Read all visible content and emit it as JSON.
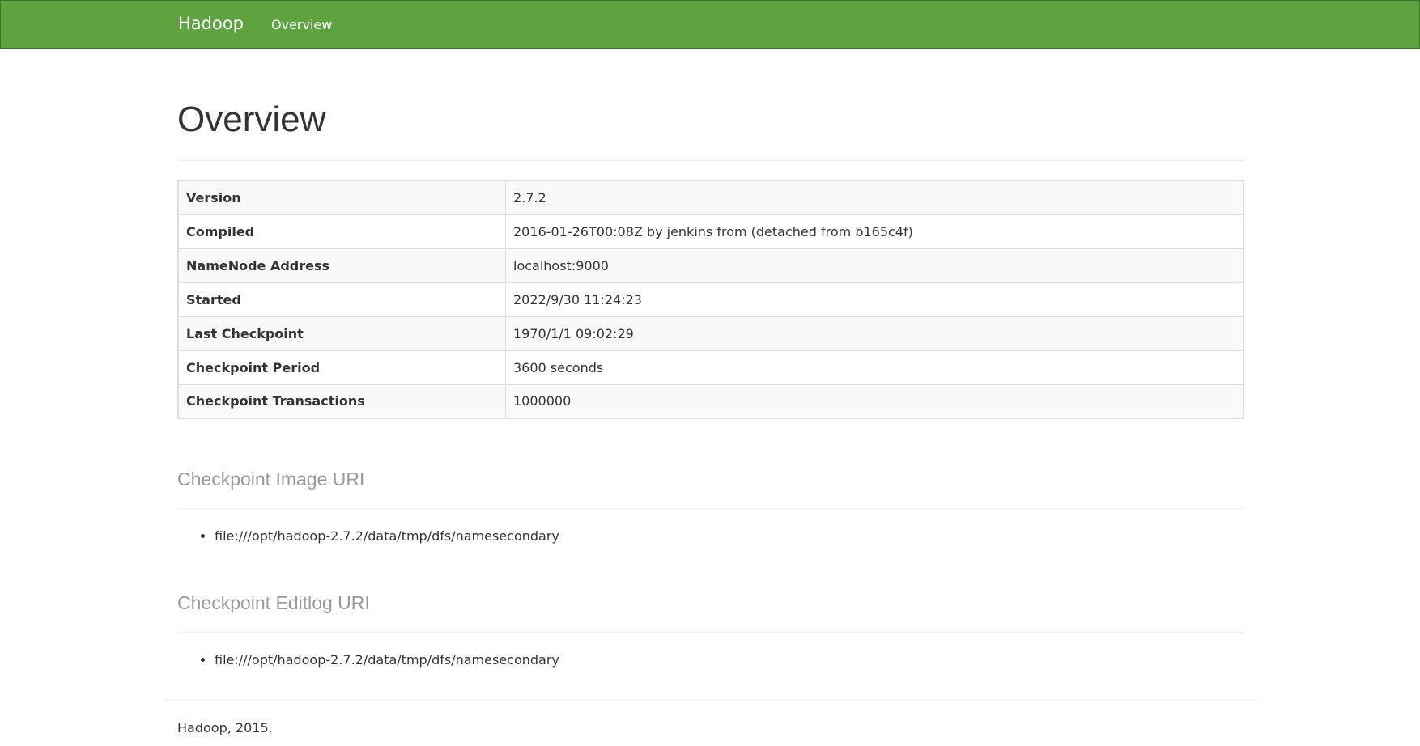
{
  "navbar": {
    "brand": "Hadoop",
    "links": [
      "Overview"
    ],
    "background_color": "#5fa341"
  },
  "page": {
    "title": "Overview"
  },
  "overview_table": [
    {
      "label": "Version",
      "value": "2.7.2"
    },
    {
      "label": "Compiled",
      "value": "2016-01-26T00:08Z by jenkins from (detached from b165c4f)"
    },
    {
      "label": "NameNode Address",
      "value": "localhost:9000"
    },
    {
      "label": "Started",
      "value": "2022/9/30 11:24:23"
    },
    {
      "label": "Last Checkpoint",
      "value": "1970/1/1 09:02:29"
    },
    {
      "label": "Checkpoint Period",
      "value": "3600 seconds"
    },
    {
      "label": "Checkpoint Transactions",
      "value": "1000000"
    }
  ],
  "checkpoint_image": {
    "heading": "Checkpoint Image URI",
    "uris": [
      "file:///opt/hadoop-2.7.2/data/tmp/dfs/namesecondary"
    ]
  },
  "checkpoint_editlog": {
    "heading": "Checkpoint Editlog URI",
    "uris": [
      "file:///opt/hadoop-2.7.2/data/tmp/dfs/namesecondary"
    ]
  },
  "footer": {
    "text": "Hadoop, 2015."
  }
}
